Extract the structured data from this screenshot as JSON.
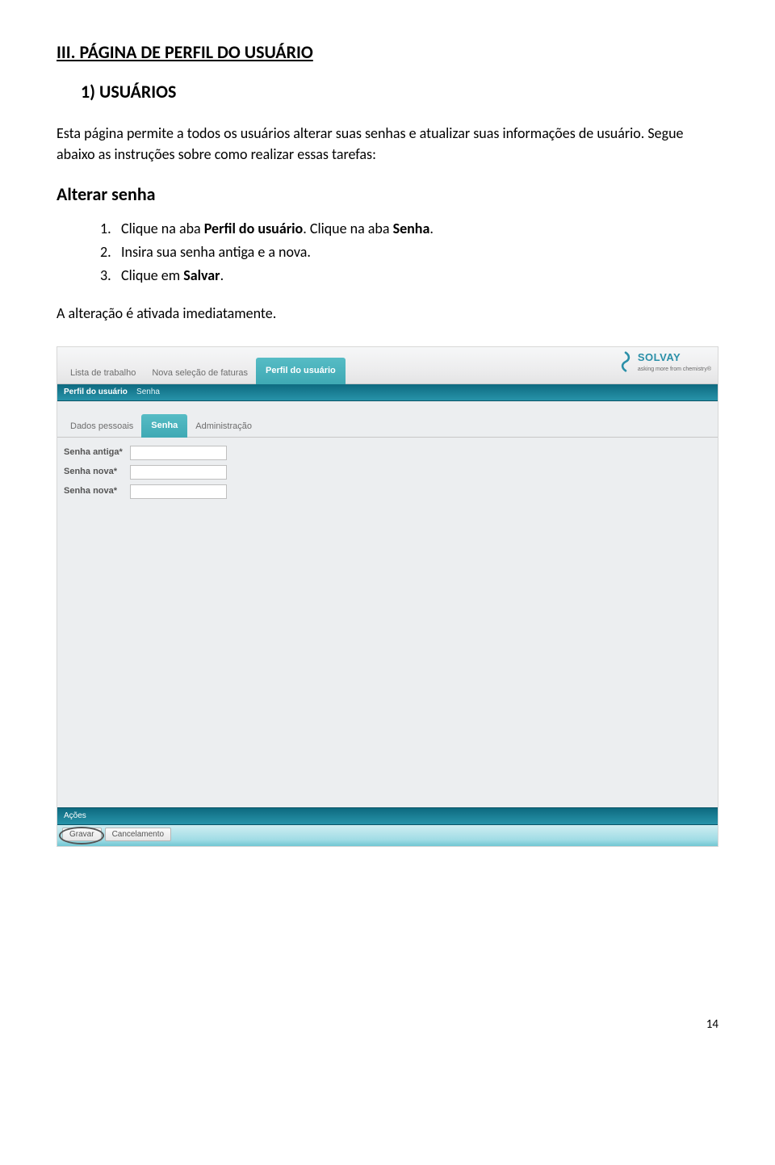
{
  "doc": {
    "section_heading": "III. PÁGINA DE PERFIL DO USUÁRIO",
    "subsection_heading": "1) USUÁRIOS",
    "intro_para": "Esta página permite a todos os usuários alterar suas senhas e atualizar suas informações de usuário. Segue abaixo as instruções sobre como realizar essas tarefas:",
    "subsubheading": "Alterar senha",
    "steps": [
      {
        "num": "1.",
        "text_before": "Clique na aba ",
        "bold1": "Perfil do usuário",
        "text_mid": ". Clique na aba ",
        "bold2": "Senha",
        "text_after": "."
      },
      {
        "num": "2.",
        "text_before": "Insira sua senha antiga e a nova.",
        "bold1": "",
        "text_mid": "",
        "bold2": "",
        "text_after": ""
      },
      {
        "num": "3.",
        "text_before": "Clique em ",
        "bold1": "Salvar",
        "text_mid": ".",
        "bold2": "",
        "text_after": ""
      }
    ],
    "closing": "A alteração é ativada imediatamente.",
    "page_number": "14"
  },
  "ui": {
    "main_tabs": {
      "worklist": "Lista de trabalho",
      "new_invoice_sel": "Nova seleção de faturas",
      "user_profile": "Perfil do usuário"
    },
    "brand": {
      "name": "SOLVAY",
      "tagline": "asking more from chemistry®"
    },
    "breadcrumb": {
      "parent": "Perfil do usuário",
      "current": "Senha"
    },
    "subtabs": {
      "personal_data": "Dados pessoais",
      "password": "Senha",
      "admin": "Administração"
    },
    "form": {
      "old_password_label": "Senha antiga*",
      "new_password_label": "Senha nova*",
      "new_password2_label": "Senha nova*"
    },
    "actions": {
      "title": "Ações",
      "save": "Gravar",
      "cancel": "Cancelamento"
    }
  }
}
